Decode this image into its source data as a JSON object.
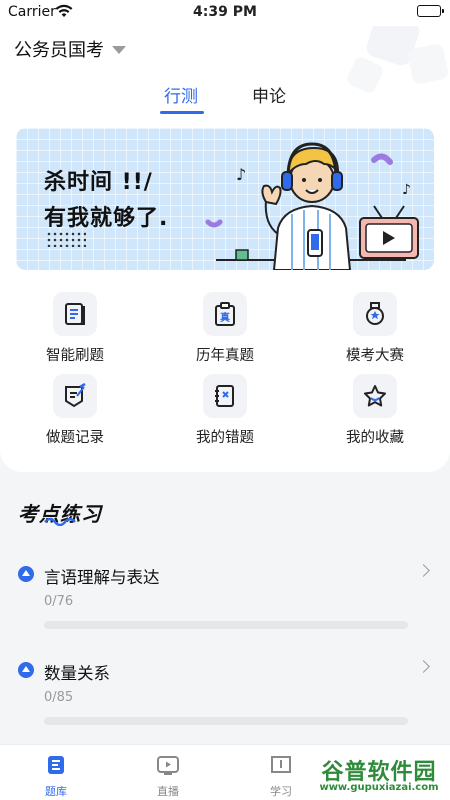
{
  "status_bar": {
    "carrier": "Carrier",
    "time": "4:39 PM"
  },
  "header": {
    "exam_title": "公务员国考"
  },
  "tabs": [
    {
      "label": "行测",
      "active": true
    },
    {
      "label": "申论",
      "active": false
    }
  ],
  "banner": {
    "line1": "杀时间 !!/",
    "line2": "有我就够了."
  },
  "features": [
    {
      "label": "智能刷题",
      "icon": "book-icon"
    },
    {
      "label": "历年真题",
      "icon": "clipboard-icon"
    },
    {
      "label": "模考大赛",
      "icon": "medal-icon"
    },
    {
      "label": "做题记录",
      "icon": "edit-note-icon"
    },
    {
      "label": "我的错题",
      "icon": "notebook-icon"
    },
    {
      "label": "我的收藏",
      "icon": "star-icon"
    }
  ],
  "clipboard_char": "真",
  "section": {
    "title": "考点练习"
  },
  "practice": [
    {
      "name": "言语理解与表达",
      "count": "0/76",
      "progress": 0
    },
    {
      "name": "数量关系",
      "count": "0/85",
      "progress": 0
    }
  ],
  "tabbar": [
    {
      "label": "题库",
      "icon": "question-bank-icon",
      "active": true
    },
    {
      "label": "直播",
      "icon": "live-tv-icon",
      "active": false
    },
    {
      "label": "学习",
      "icon": "study-book-icon",
      "active": false
    }
  ],
  "watermark": {
    "text": "谷普软件园",
    "url": "www.gupuxiazai.com"
  },
  "colors": {
    "accent": "#2f6bea",
    "background": "#f4f5f7",
    "banner": "#cfe6fb"
  }
}
